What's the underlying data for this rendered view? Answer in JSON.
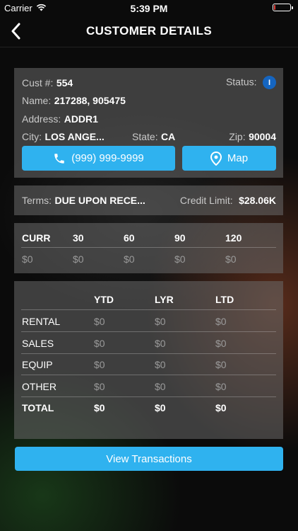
{
  "status_bar": {
    "carrier": "Carrier",
    "time": "5:39 PM"
  },
  "header": {
    "title": "CUSTOMER DETAILS"
  },
  "customer": {
    "cust_label": "Cust #:",
    "cust_value": "554",
    "status_label": "Status:",
    "status_value": "I",
    "name_label": "Name:",
    "name_value": "217288, 905475",
    "address_label": "Address:",
    "address_value": "ADDR1",
    "city_label": "City:",
    "city_value": "LOS ANGE...",
    "state_label": "State:",
    "state_value": "CA",
    "zip_label": "Zip:",
    "zip_value": "90004",
    "phone_button": "(999) 999-9999",
    "map_button": "Map"
  },
  "terms": {
    "terms_label": "Terms:",
    "terms_value": "DUE UPON RECE...",
    "credit_label": "Credit Limit:",
    "credit_value": "$28.06K"
  },
  "aging": {
    "headers": [
      "CURR",
      "30",
      "60",
      "90",
      "120"
    ],
    "values": [
      "$0",
      "$0",
      "$0",
      "$0",
      "$0"
    ]
  },
  "summary": {
    "columns": [
      "YTD",
      "LYR",
      "LTD"
    ],
    "rows": [
      {
        "label": "RENTAL",
        "values": [
          "$0",
          "$0",
          "$0"
        ]
      },
      {
        "label": "SALES",
        "values": [
          "$0",
          "$0",
          "$0"
        ]
      },
      {
        "label": "EQUIP",
        "values": [
          "$0",
          "$0",
          "$0"
        ]
      },
      {
        "label": "OTHER",
        "values": [
          "$0",
          "$0",
          "$0"
        ]
      }
    ],
    "total": {
      "label": "TOTAL",
      "values": [
        "$0",
        "$0",
        "$0"
      ]
    }
  },
  "actions": {
    "view_transactions": "View Transactions"
  },
  "colors": {
    "accent": "#2fb2ef",
    "status_badge": "#1565c0",
    "battery_low": "#e0403a"
  }
}
